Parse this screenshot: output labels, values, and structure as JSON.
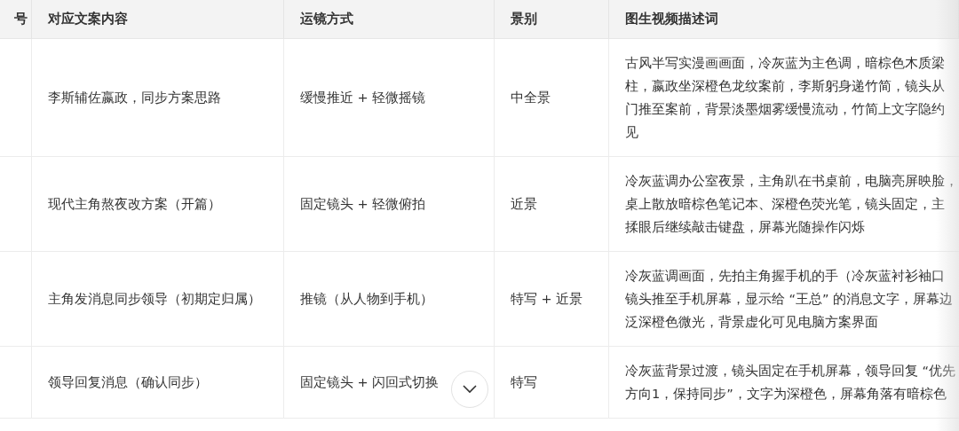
{
  "table": {
    "columns": [
      {
        "label": "号"
      },
      {
        "label": "对应文案内容"
      },
      {
        "label": "运镜方式"
      },
      {
        "label": "景别"
      },
      {
        "label": "图生视频描述词"
      }
    ],
    "rows": [
      {
        "copy": "李斯辅佐嬴政，同步方案思路",
        "camera": "缓慢推近 + 轻微摇镜",
        "shot": "中全景",
        "prompt_lines": [
          "古风半写实漫画画面，冷灰蓝为主色调，暗棕色木质梁",
          "柱，嬴政坐深橙色龙纹案前，李斯躬身递竹简，镜头从",
          "门推至案前，背景淡墨烟雾缓慢流动，竹简上文字隐约",
          "见"
        ]
      },
      {
        "copy": "现代主角熬夜改方案（开篇）",
        "camera": "固定镜头 + 轻微俯拍",
        "shot": "近景",
        "prompt_lines": [
          "冷灰蓝调办公室夜景，主角趴在书桌前，电脑亮屏映脸，",
          "桌上散放暗棕色笔记本、深橙色荧光笔，镜头固定，主",
          "揉眼后继续敲击键盘，屏幕光随操作闪烁"
        ]
      },
      {
        "copy": "主角发消息同步领导（初期定归属）",
        "camera": "推镜（从人物到手机）",
        "shot": "特写 + 近景",
        "prompt_lines": [
          "冷灰蓝调画面，先拍主角握手机的手（冷灰蓝衬衫袖口",
          "镜头推至手机屏幕，显示给 “王总” 的消息文字，屏幕边",
          "泛深橙色微光，背景虚化可见电脑方案界面"
        ]
      },
      {
        "copy": "领导回复消息（确认同步）",
        "camera": "固定镜头 + 闪回式切换",
        "shot": "特写",
        "prompt_lines": [
          "冷灰蓝背景过渡，镜头固定在手机屏幕，领导回复 “优先",
          "方向1，保持同步”，文字为深橙色，屏幕角落有暗棕色"
        ]
      }
    ]
  }
}
